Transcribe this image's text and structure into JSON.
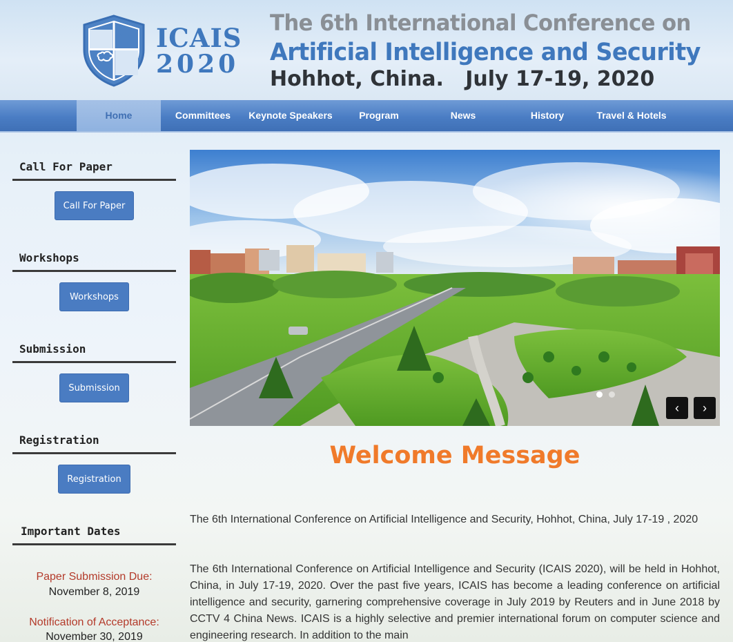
{
  "header": {
    "logo_line_1": "ICAIS",
    "logo_line_2": "2020",
    "title_line_1": "The 6th International Conference on",
    "title_line_2": "Artificial Intelligence and Security",
    "title_line_3": "Hohhot, China.   July 17-19, 2020"
  },
  "nav": {
    "items": [
      {
        "label": "Home"
      },
      {
        "label": "Committees"
      },
      {
        "label": "Keynote Speakers"
      },
      {
        "label": "Program"
      },
      {
        "label": "News"
      },
      {
        "label": "History"
      },
      {
        "label": "Travel & Hotels"
      }
    ]
  },
  "sidebar": {
    "call_for_paper": {
      "title": "Call For Paper",
      "button": "Call For Paper"
    },
    "workshops": {
      "title": "Workshops",
      "button": "Workshops"
    },
    "submission": {
      "title": "Submission",
      "button": "Submission"
    },
    "registration": {
      "title": "Registration",
      "button": "Registration"
    },
    "important_dates": {
      "title": "Important Dates",
      "items": [
        {
          "label": "Paper Submission Due:",
          "value": "November 8, 2019"
        },
        {
          "label": "Notification of Acceptance:",
          "value": "November 30, 2019"
        }
      ]
    }
  },
  "carousel": {
    "prev_label": "‹",
    "next_label": "›"
  },
  "main": {
    "heading": "Welcome Message",
    "para_1": "The 6th International Conference on Artificial Intelligence and Security, Hohhot, China, July 17-19 , 2020",
    "para_2": "The 6th International Conference on Artificial Intelligence and Security (ICAIS 2020), will be held in Hohhot, China, in July 17-19, 2020. Over the past five years, ICAIS has become a leading conference on artificial intelligence and security, garnering comprehensive coverage in July 2019 by Reuters and in June 2018 by CCTV 4 China News. ICAIS is a highly selective and premier international forum on computer science and engineering research. In addition to the main"
  },
  "colors": {
    "brand_blue": "#3f78bd",
    "nav_blue": "#4a7dc4",
    "button_blue": "#4a7cc2",
    "accent_orange": "#f07a2a",
    "date_red": "#b33a2a"
  }
}
